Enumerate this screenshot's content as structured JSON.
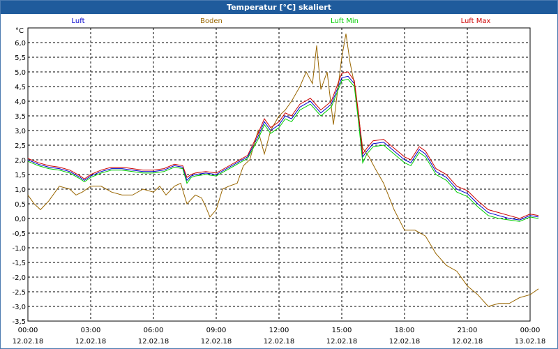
{
  "window": {
    "title": "Temperatur [°C] skaliert"
  },
  "chart_data": {
    "type": "line",
    "title": "Temperatur [°C] skaliert",
    "ylabel": "°C",
    "xlabel": "",
    "ylim": [
      -3.5,
      6.5
    ],
    "xlim": [
      0,
      24
    ],
    "grid": true,
    "legend_position": "top",
    "y_ticks": [
      "-3,5",
      "-3,0",
      "-2,5",
      "-2,0",
      "-1,5",
      "-1,0",
      "-0,5",
      "0,0",
      "0,5",
      "1,0",
      "1,5",
      "2,0",
      "2,5",
      "3,0",
      "3,5",
      "4,0",
      "4,5",
      "5,0",
      "5,5",
      "6,0"
    ],
    "x_ticks": [
      {
        "time": "00:00",
        "date": "12.02.18"
      },
      {
        "time": "03:00",
        "date": "12.02.18"
      },
      {
        "time": "06:00",
        "date": "12.02.18"
      },
      {
        "time": "09:00",
        "date": "12.02.18"
      },
      {
        "time": "12:00",
        "date": "12.02.18"
      },
      {
        "time": "15:00",
        "date": "12.02.18"
      },
      {
        "time": "18:00",
        "date": "12.02.18"
      },
      {
        "time": "21:00",
        "date": "12.02.18"
      },
      {
        "time": "00:00",
        "date": "13.02.18"
      }
    ],
    "series": [
      {
        "name": "Luft",
        "color": "#0000cc",
        "points": [
          [
            0,
            2.0
          ],
          [
            0.5,
            1.85
          ],
          [
            1,
            1.75
          ],
          [
            1.5,
            1.7
          ],
          [
            2,
            1.6
          ],
          [
            2.5,
            1.4
          ],
          [
            2.7,
            1.3
          ],
          [
            3,
            1.45
          ],
          [
            3.5,
            1.6
          ],
          [
            4,
            1.7
          ],
          [
            4.5,
            1.7
          ],
          [
            5,
            1.65
          ],
          [
            5.5,
            1.6
          ],
          [
            6,
            1.6
          ],
          [
            6.5,
            1.65
          ],
          [
            7,
            1.8
          ],
          [
            7.4,
            1.75
          ],
          [
            7.6,
            1.3
          ],
          [
            7.8,
            1.45
          ],
          [
            8,
            1.5
          ],
          [
            8.5,
            1.55
          ],
          [
            9,
            1.5
          ],
          [
            9.5,
            1.7
          ],
          [
            10,
            1.9
          ],
          [
            10.5,
            2.1
          ],
          [
            11,
            2.8
          ],
          [
            11.3,
            3.3
          ],
          [
            11.6,
            3.0
          ],
          [
            12,
            3.2
          ],
          [
            12.3,
            3.5
          ],
          [
            12.6,
            3.4
          ],
          [
            13,
            3.8
          ],
          [
            13.5,
            4.0
          ],
          [
            14,
            3.6
          ],
          [
            14.5,
            3.9
          ],
          [
            15,
            4.8
          ],
          [
            15.3,
            4.85
          ],
          [
            15.6,
            4.6
          ],
          [
            15.8,
            3.5
          ],
          [
            16,
            2.1
          ],
          [
            16.2,
            2.3
          ],
          [
            16.5,
            2.55
          ],
          [
            17,
            2.6
          ],
          [
            17.5,
            2.3
          ],
          [
            18,
            2.0
          ],
          [
            18.3,
            1.9
          ],
          [
            18.7,
            2.35
          ],
          [
            19,
            2.2
          ],
          [
            19.5,
            1.6
          ],
          [
            20,
            1.4
          ],
          [
            20.5,
            1.0
          ],
          [
            21,
            0.85
          ],
          [
            21.5,
            0.5
          ],
          [
            22,
            0.2
          ],
          [
            22.5,
            0.1
          ],
          [
            23,
            0.0
          ],
          [
            23.5,
            -0.05
          ],
          [
            24,
            0.1
          ],
          [
            24.4,
            0.05
          ]
        ]
      },
      {
        "name": "Boden",
        "color": "#996600",
        "points": [
          [
            0,
            0.8
          ],
          [
            0.3,
            0.5
          ],
          [
            0.6,
            0.3
          ],
          [
            1,
            0.6
          ],
          [
            1.5,
            1.1
          ],
          [
            2,
            1.0
          ],
          [
            2.3,
            0.8
          ],
          [
            2.6,
            0.9
          ],
          [
            3,
            1.1
          ],
          [
            3.5,
            1.1
          ],
          [
            4,
            0.9
          ],
          [
            4.5,
            0.8
          ],
          [
            5,
            0.8
          ],
          [
            5.5,
            1.0
          ],
          [
            6,
            0.9
          ],
          [
            6.3,
            1.1
          ],
          [
            6.6,
            0.8
          ],
          [
            7,
            1.1
          ],
          [
            7.3,
            1.2
          ],
          [
            7.6,
            0.5
          ],
          [
            8,
            0.8
          ],
          [
            8.3,
            0.7
          ],
          [
            8.5,
            0.4
          ],
          [
            8.7,
            0.05
          ],
          [
            9,
            0.3
          ],
          [
            9.3,
            1.0
          ],
          [
            9.6,
            1.1
          ],
          [
            10,
            1.2
          ],
          [
            10.3,
            1.8
          ],
          [
            10.6,
            2.0
          ],
          [
            11,
            3.0
          ],
          [
            11.3,
            2.2
          ],
          [
            11.6,
            3.0
          ],
          [
            12,
            3.5
          ],
          [
            12.3,
            3.7
          ],
          [
            12.6,
            4.0
          ],
          [
            13,
            4.5
          ],
          [
            13.3,
            5.0
          ],
          [
            13.6,
            4.6
          ],
          [
            13.8,
            5.9
          ],
          [
            14,
            4.4
          ],
          [
            14.3,
            5.0
          ],
          [
            14.6,
            3.2
          ],
          [
            15,
            5.5
          ],
          [
            15.2,
            6.3
          ],
          [
            15.4,
            5.3
          ],
          [
            15.6,
            4.6
          ],
          [
            15.8,
            3.5
          ],
          [
            16,
            2.4
          ],
          [
            16.3,
            2.1
          ],
          [
            16.6,
            1.7
          ],
          [
            17,
            1.2
          ],
          [
            17.5,
            0.3
          ],
          [
            18,
            -0.4
          ],
          [
            18.5,
            -0.4
          ],
          [
            19,
            -0.6
          ],
          [
            19.5,
            -1.2
          ],
          [
            20,
            -1.6
          ],
          [
            20.5,
            -1.8
          ],
          [
            21,
            -2.3
          ],
          [
            21.5,
            -2.6
          ],
          [
            22,
            -3.0
          ],
          [
            22.5,
            -2.9
          ],
          [
            23,
            -2.9
          ],
          [
            23.5,
            -2.7
          ],
          [
            24,
            -2.6
          ],
          [
            24.4,
            -2.4
          ]
        ]
      },
      {
        "name": "Luft Min",
        "color": "#00cc00",
        "points": [
          [
            0,
            1.95
          ],
          [
            0.5,
            1.8
          ],
          [
            1,
            1.7
          ],
          [
            1.5,
            1.65
          ],
          [
            2,
            1.55
          ],
          [
            2.5,
            1.35
          ],
          [
            2.7,
            1.25
          ],
          [
            3,
            1.4
          ],
          [
            3.5,
            1.55
          ],
          [
            4,
            1.65
          ],
          [
            4.5,
            1.65
          ],
          [
            5,
            1.6
          ],
          [
            5.5,
            1.55
          ],
          [
            6,
            1.55
          ],
          [
            6.5,
            1.6
          ],
          [
            7,
            1.75
          ],
          [
            7.4,
            1.7
          ],
          [
            7.6,
            1.2
          ],
          [
            7.8,
            1.4
          ],
          [
            8,
            1.45
          ],
          [
            8.5,
            1.5
          ],
          [
            9,
            1.45
          ],
          [
            9.5,
            1.65
          ],
          [
            10,
            1.85
          ],
          [
            10.5,
            2.05
          ],
          [
            11,
            2.7
          ],
          [
            11.3,
            3.2
          ],
          [
            11.6,
            2.9
          ],
          [
            12,
            3.1
          ],
          [
            12.3,
            3.4
          ],
          [
            12.6,
            3.3
          ],
          [
            13,
            3.7
          ],
          [
            13.5,
            3.9
          ],
          [
            14,
            3.5
          ],
          [
            14.5,
            3.8
          ],
          [
            15,
            4.7
          ],
          [
            15.3,
            4.75
          ],
          [
            15.6,
            4.5
          ],
          [
            15.8,
            3.3
          ],
          [
            16,
            1.9
          ],
          [
            16.2,
            2.2
          ],
          [
            16.5,
            2.45
          ],
          [
            17,
            2.5
          ],
          [
            17.5,
            2.2
          ],
          [
            18,
            1.9
          ],
          [
            18.3,
            1.8
          ],
          [
            18.7,
            2.25
          ],
          [
            19,
            2.1
          ],
          [
            19.5,
            1.5
          ],
          [
            20,
            1.3
          ],
          [
            20.5,
            0.9
          ],
          [
            21,
            0.75
          ],
          [
            21.5,
            0.4
          ],
          [
            22,
            0.1
          ],
          [
            22.5,
            0.0
          ],
          [
            23,
            -0.05
          ],
          [
            23.5,
            -0.1
          ],
          [
            24,
            0.05
          ],
          [
            24.4,
            0.0
          ]
        ]
      },
      {
        "name": "Luft Max",
        "color": "#cc0000",
        "points": [
          [
            0,
            2.05
          ],
          [
            0.5,
            1.9
          ],
          [
            1,
            1.8
          ],
          [
            1.5,
            1.75
          ],
          [
            2,
            1.65
          ],
          [
            2.5,
            1.45
          ],
          [
            2.7,
            1.35
          ],
          [
            3,
            1.5
          ],
          [
            3.5,
            1.65
          ],
          [
            4,
            1.75
          ],
          [
            4.5,
            1.75
          ],
          [
            5,
            1.7
          ],
          [
            5.5,
            1.65
          ],
          [
            6,
            1.65
          ],
          [
            6.5,
            1.7
          ],
          [
            7,
            1.85
          ],
          [
            7.4,
            1.8
          ],
          [
            7.6,
            1.4
          ],
          [
            7.8,
            1.5
          ],
          [
            8,
            1.55
          ],
          [
            8.5,
            1.6
          ],
          [
            9,
            1.55
          ],
          [
            9.5,
            1.75
          ],
          [
            10,
            1.95
          ],
          [
            10.5,
            2.15
          ],
          [
            11,
            2.9
          ],
          [
            11.3,
            3.4
          ],
          [
            11.6,
            3.1
          ],
          [
            12,
            3.3
          ],
          [
            12.3,
            3.6
          ],
          [
            12.6,
            3.5
          ],
          [
            13,
            3.9
          ],
          [
            13.5,
            4.1
          ],
          [
            14,
            3.7
          ],
          [
            14.5,
            4.0
          ],
          [
            15,
            4.95
          ],
          [
            15.3,
            5.0
          ],
          [
            15.6,
            4.7
          ],
          [
            15.8,
            3.6
          ],
          [
            16,
            2.2
          ],
          [
            16.2,
            2.4
          ],
          [
            16.5,
            2.65
          ],
          [
            17,
            2.7
          ],
          [
            17.5,
            2.4
          ],
          [
            18,
            2.1
          ],
          [
            18.3,
            2.0
          ],
          [
            18.7,
            2.45
          ],
          [
            19,
            2.3
          ],
          [
            19.5,
            1.7
          ],
          [
            20,
            1.5
          ],
          [
            20.5,
            1.1
          ],
          [
            21,
            0.95
          ],
          [
            21.5,
            0.6
          ],
          [
            22,
            0.3
          ],
          [
            22.5,
            0.2
          ],
          [
            23,
            0.1
          ],
          [
            23.5,
            0.0
          ],
          [
            24,
            0.15
          ],
          [
            24.4,
            0.1
          ]
        ]
      }
    ]
  }
}
